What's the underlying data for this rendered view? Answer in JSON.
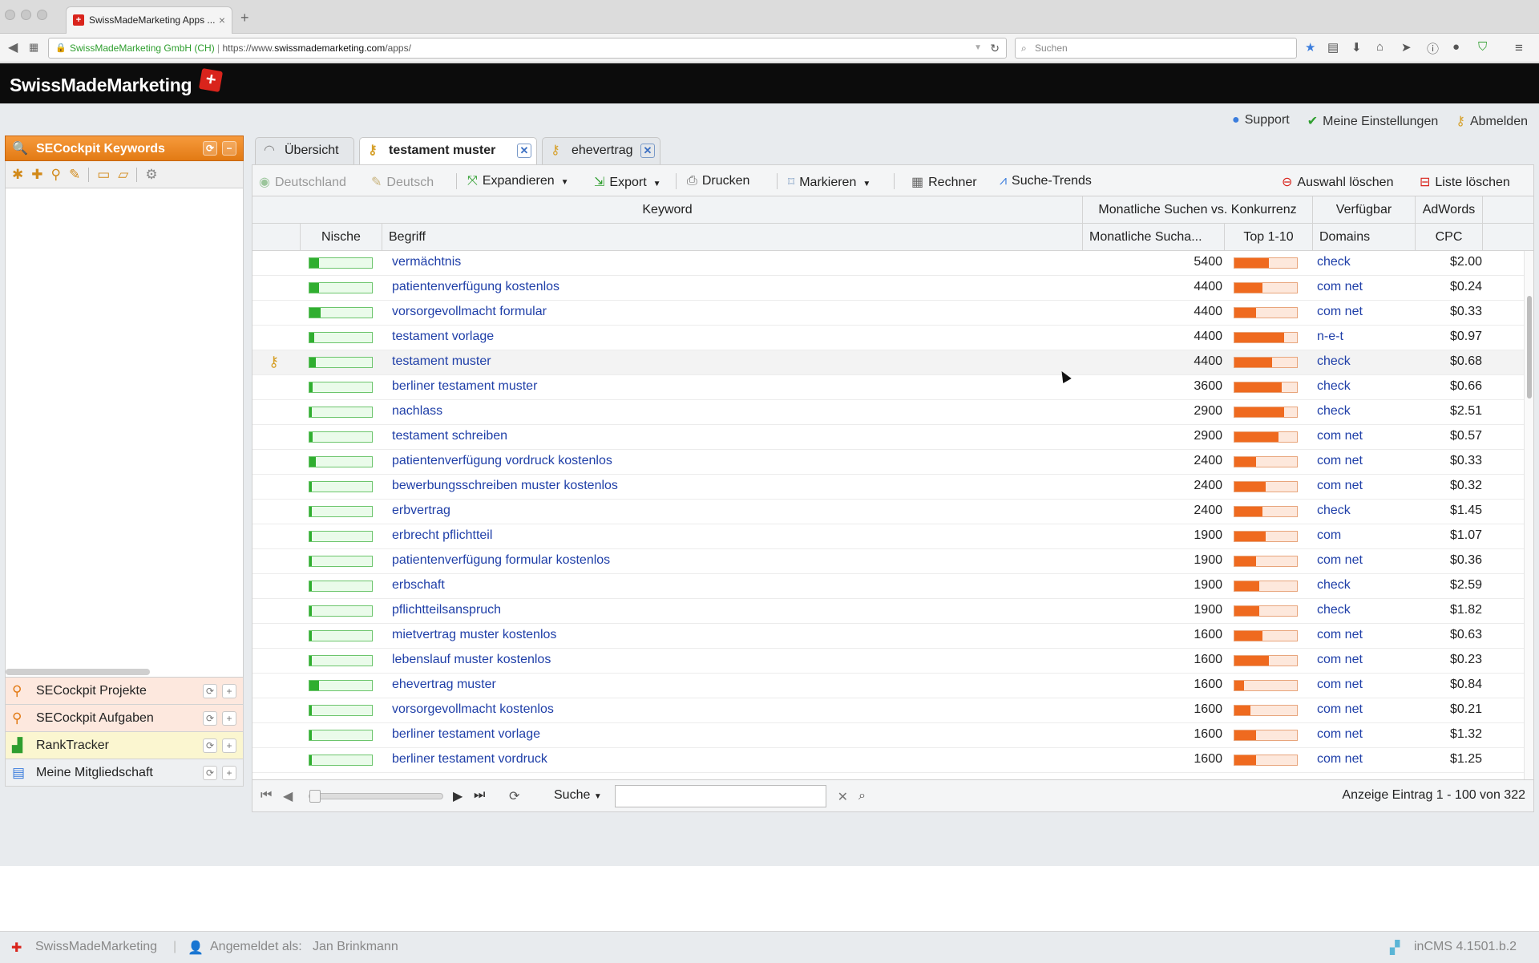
{
  "browser": {
    "tab_title": "SwissMadeMarketing Apps ...",
    "tab_close": "×",
    "new_tab": "+",
    "url_org": "SwissMadeMarketing GmbH (CH)",
    "url_prefix": "https://www.",
    "url_host": "swissmademarketing.com",
    "url_path": "/apps/",
    "search_placeholder": "Suchen"
  },
  "app": {
    "logo": "SwissMadeMarketing",
    "logo_cross": "+"
  },
  "toplinks": {
    "support": "Support",
    "settings": "Meine Einstellungen",
    "logout": "Abmelden"
  },
  "sidebar": {
    "title": "SECockpit Keywords",
    "items": [
      {
        "label": "SECockpit Projekte"
      },
      {
        "label": "SECockpit Aufgaben"
      },
      {
        "label": "RankTracker"
      },
      {
        "label": "Meine Mitgliedschaft"
      }
    ]
  },
  "tabs": [
    {
      "label": "Übersicht"
    },
    {
      "label": "testament muster",
      "close": "✕"
    },
    {
      "label": "ehevertrag",
      "close": "✕"
    }
  ],
  "toolbar": {
    "country": "Deutschland",
    "language": "Deutsch",
    "expand": "Expandieren",
    "export": "Export",
    "print": "Drucken",
    "mark": "Markieren",
    "calculator": "Rechner",
    "trends": "Suche-Trends",
    "clear_selection": "Auswahl löschen",
    "clear_list": "Liste löschen"
  },
  "grid": {
    "group_headers": {
      "keyword": "Keyword",
      "monthly_vs_comp": "Monatliche Suchen vs. Konkurrenz",
      "available": "Verfügbar",
      "adwords": "AdWords"
    },
    "columns": {
      "niche": "Nische",
      "term": "Begriff",
      "monthly": "Monatliche Sucha...",
      "top10": "Top 1-10",
      "domains": "Domains",
      "cpc": "CPC"
    },
    "rows": [
      {
        "term": "vermächtnis",
        "searches": "5400",
        "domains": "check",
        "cpc": "$2.00",
        "niche": 0.15,
        "comp": 0.55
      },
      {
        "term": "patientenverfügung kostenlos",
        "searches": "4400",
        "domains": "com net",
        "cpc": "$0.24",
        "niche": 0.15,
        "comp": 0.45
      },
      {
        "term": "vorsorgevollmacht formular",
        "searches": "4400",
        "domains": "com net",
        "cpc": "$0.33",
        "niche": 0.18,
        "comp": 0.35
      },
      {
        "term": "testament vorlage",
        "searches": "4400",
        "domains": "n-e-t",
        "cpc": "$0.97",
        "niche": 0.08,
        "comp": 0.8
      },
      {
        "term": "testament muster",
        "searches": "4400",
        "domains": "check",
        "cpc": "$0.68",
        "niche": 0.1,
        "comp": 0.6,
        "selected": true
      },
      {
        "term": "berliner testament muster",
        "searches": "3600",
        "domains": "check",
        "cpc": "$0.66",
        "niche": 0.05,
        "comp": 0.75
      },
      {
        "term": "nachlass",
        "searches": "2900",
        "domains": "check",
        "cpc": "$2.51",
        "niche": 0.04,
        "comp": 0.8
      },
      {
        "term": "testament schreiben",
        "searches": "2900",
        "domains": "com net",
        "cpc": "$0.57",
        "niche": 0.05,
        "comp": 0.7
      },
      {
        "term": "patientenverfügung vordruck kostenlos",
        "searches": "2400",
        "domains": "com net",
        "cpc": "$0.33",
        "niche": 0.1,
        "comp": 0.35
      },
      {
        "term": "bewerbungsschreiben muster kostenlos",
        "searches": "2400",
        "domains": "com net",
        "cpc": "$0.32",
        "niche": 0.04,
        "comp": 0.5
      },
      {
        "term": "erbvertrag",
        "searches": "2400",
        "domains": "check",
        "cpc": "$1.45",
        "niche": 0.04,
        "comp": 0.45
      },
      {
        "term": "erbrecht pflichtteil",
        "searches": "1900",
        "domains": "com",
        "cpc": "$1.07",
        "niche": 0.04,
        "comp": 0.5
      },
      {
        "term": "patientenverfügung formular kostenlos",
        "searches": "1900",
        "domains": "com net",
        "cpc": "$0.36",
        "niche": 0.04,
        "comp": 0.35
      },
      {
        "term": "erbschaft",
        "searches": "1900",
        "domains": "check",
        "cpc": "$2.59",
        "niche": 0.04,
        "comp": 0.4
      },
      {
        "term": "pflichtteilsanspruch",
        "searches": "1900",
        "domains": "check",
        "cpc": "$1.82",
        "niche": 0.04,
        "comp": 0.4
      },
      {
        "term": "mietvertrag muster kostenlos",
        "searches": "1600",
        "domains": "com net",
        "cpc": "$0.63",
        "niche": 0.04,
        "comp": 0.45
      },
      {
        "term": "lebenslauf muster kostenlos",
        "searches": "1600",
        "domains": "com net",
        "cpc": "$0.23",
        "niche": 0.04,
        "comp": 0.55
      },
      {
        "term": "ehevertrag muster",
        "searches": "1600",
        "domains": "com net",
        "cpc": "$0.84",
        "niche": 0.15,
        "comp": 0.15
      },
      {
        "term": "vorsorgevollmacht kostenlos",
        "searches": "1600",
        "domains": "com net",
        "cpc": "$0.21",
        "niche": 0.04,
        "comp": 0.25
      },
      {
        "term": "berliner testament vorlage",
        "searches": "1600",
        "domains": "com net",
        "cpc": "$1.32",
        "niche": 0.04,
        "comp": 0.35
      },
      {
        "term": "berliner testament vordruck",
        "searches": "1600",
        "domains": "com net",
        "cpc": "$1.25",
        "niche": 0.04,
        "comp": 0.35
      }
    ]
  },
  "pager": {
    "search_label": "Suche",
    "info": "Anzeige Eintrag 1 - 100 von 322"
  },
  "footer": {
    "brand": "SwissMadeMarketing",
    "logged_in_label": "Angemeldet als:",
    "user": "Jan Brinkmann",
    "version": "inCMS 4.1501.b.2"
  }
}
